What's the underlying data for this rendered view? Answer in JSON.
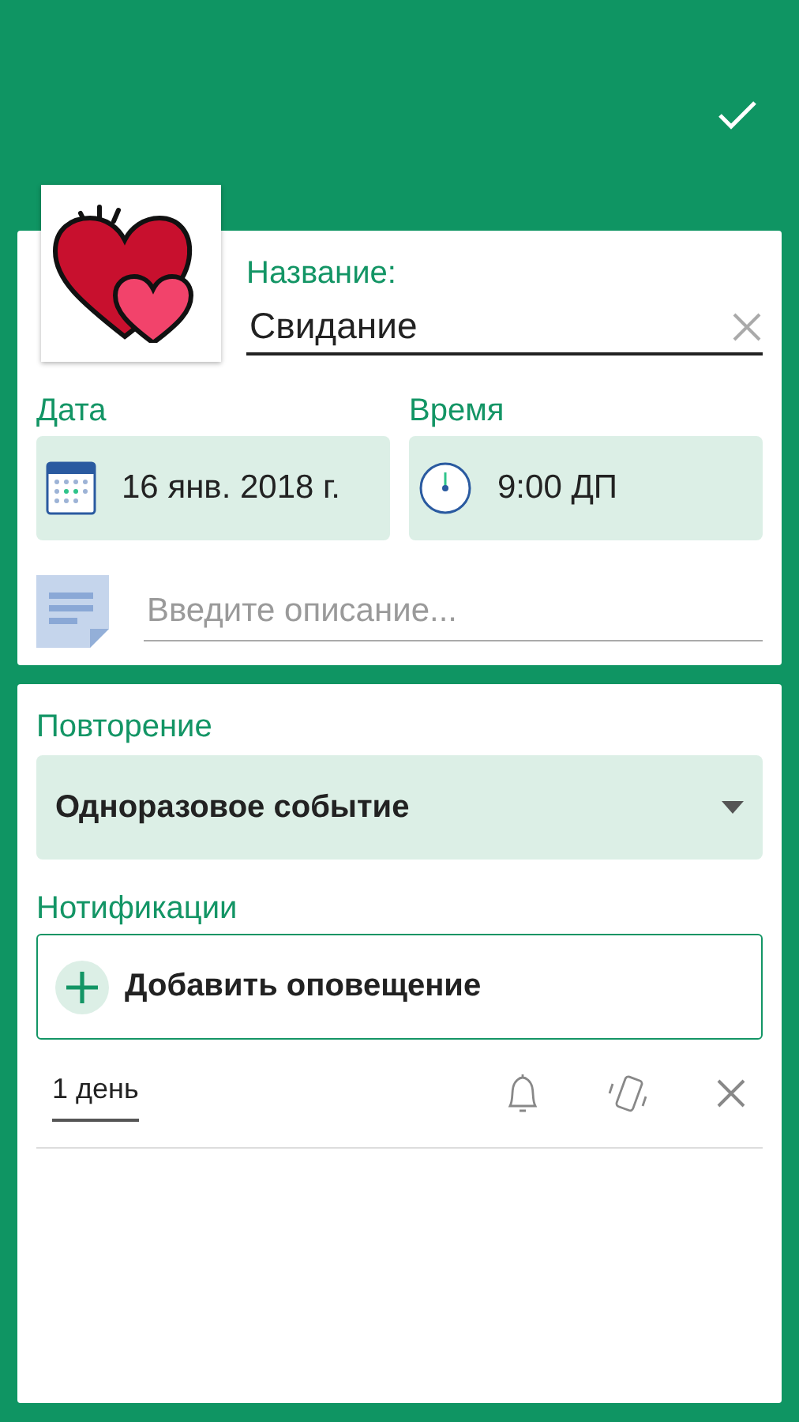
{
  "event": {
    "name_label": "Название:",
    "name_value": "Свидание",
    "date_label": "Дата",
    "date_value": "16 янв. 2018 г.",
    "time_label": "Время",
    "time_value": "9:00 ДП",
    "description_placeholder": "Введите описание..."
  },
  "repeat": {
    "label": "Повторение",
    "value": "Одноразовое событие"
  },
  "notifications": {
    "label": "Нотификации",
    "add_button": "Добавить оповещение",
    "items": [
      {
        "offset": "1 день"
      }
    ]
  }
}
